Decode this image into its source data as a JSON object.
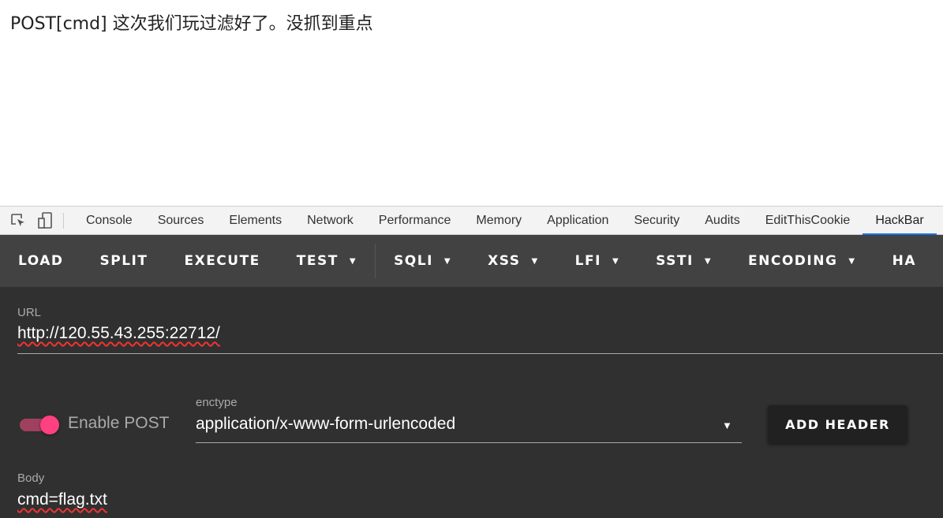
{
  "page": {
    "text": "POST[cmd] 这次我们玩过滤好了。没抓到重点"
  },
  "devtools": {
    "tabs": [
      "Console",
      "Sources",
      "Elements",
      "Network",
      "Performance",
      "Memory",
      "Application",
      "Security",
      "Audits",
      "EditThisCookie",
      "HackBar"
    ],
    "active_tab": "HackBar"
  },
  "hackbar": {
    "toolbar": [
      {
        "label": "LOAD"
      },
      {
        "label": "SPLIT"
      },
      {
        "label": "EXECUTE"
      },
      {
        "label": "TEST",
        "dropdown": true
      },
      {
        "label": "SQLI",
        "dropdown": true
      },
      {
        "label": "XSS",
        "dropdown": true
      },
      {
        "label": "LFI",
        "dropdown": true
      },
      {
        "label": "SSTI",
        "dropdown": true
      },
      {
        "label": "ENCODING",
        "dropdown": true
      },
      {
        "label": "HA"
      }
    ],
    "url_label": "URL",
    "url": "http://120.55.43.255:22712/",
    "enable_post_label": "Enable POST",
    "enable_post": true,
    "enctype_label": "enctype",
    "enctype": "application/x-www-form-urlencoded",
    "add_header": "ADD HEADER",
    "body_label": "Body",
    "body": "cmd=flag.txt"
  },
  "colors": {
    "accent": "#ff4081",
    "active_tab": "#1a73e8",
    "toolbar": "#424242",
    "panel": "#303030"
  }
}
